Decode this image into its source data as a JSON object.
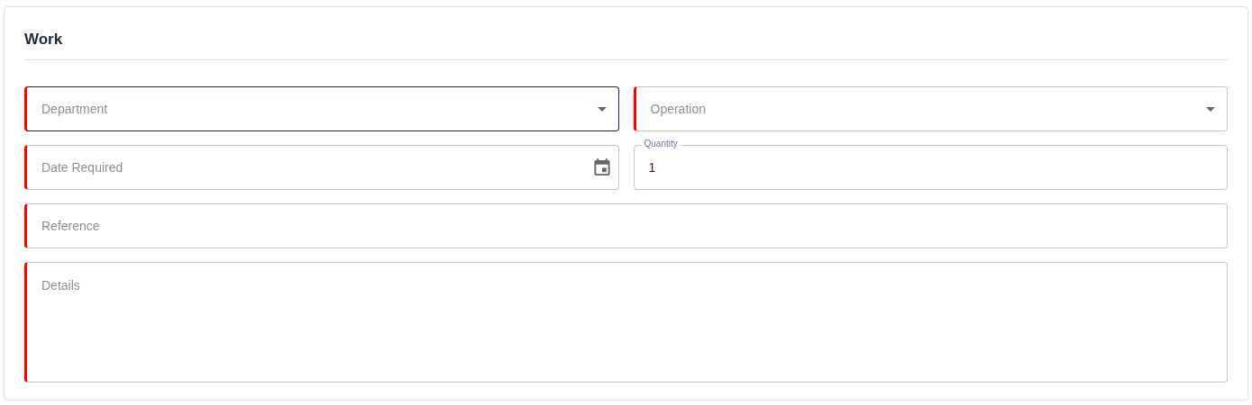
{
  "section": {
    "title": "Work"
  },
  "rows": [
    [
      {
        "kind": "select",
        "placeholder": "Department",
        "required": true,
        "focused": true
      },
      {
        "kind": "select",
        "placeholder": "Operation",
        "required": true,
        "focused": false
      }
    ],
    [
      {
        "kind": "date",
        "placeholder": "Date Required",
        "required": true,
        "focused": false
      },
      {
        "kind": "number",
        "label": "Quantity",
        "value": "1",
        "required": false,
        "focused": false
      }
    ],
    [
      {
        "kind": "text",
        "placeholder": "Reference",
        "required": true,
        "focused": false
      }
    ],
    [
      {
        "kind": "textarea",
        "placeholder": "Details",
        "required": true,
        "focused": false
      }
    ]
  ]
}
